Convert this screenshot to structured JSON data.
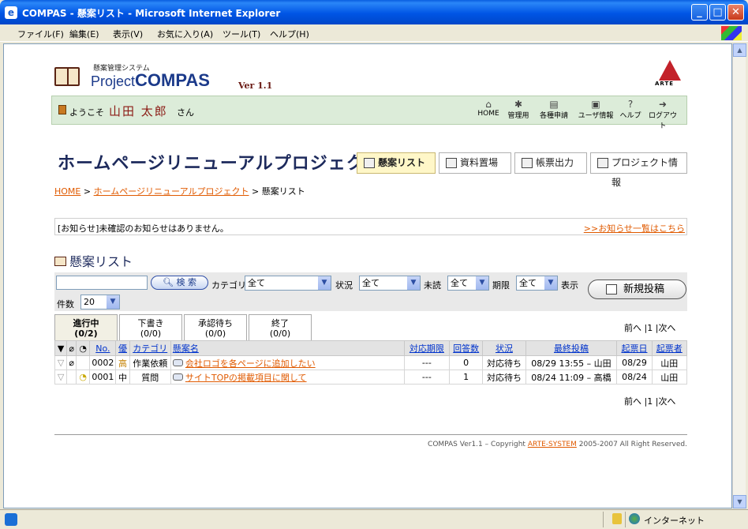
{
  "window": {
    "title": "COMPAS - 懸案リスト - Microsoft Internet Explorer"
  },
  "menu": [
    "ファイル(F)",
    "編集(E)",
    "表示(V)",
    "お気に入り(A)",
    "ツール(T)",
    "ヘルプ(H)"
  ],
  "logo": {
    "subtitle": "懸案管理システム",
    "project": "Project",
    "name": "COMPAS",
    "version": "Ver 1.1",
    "brand": "ARTE"
  },
  "welcome": {
    "prefix": "ようこそ",
    "user": "山田 太郎",
    "suffix": "さん"
  },
  "nav": [
    "HOME",
    "管理用",
    "各種申請",
    "ユーザ情報",
    "ヘルプ",
    "ログアウト"
  ],
  "project_title": "ホームページリニューアルプロジェクト",
  "tabs": [
    "懸案リスト",
    "資料置場",
    "帳票出力",
    "プロジェクト情報"
  ],
  "breadcrumb": {
    "home": "HOME",
    "project": "ホームページリニューアルプロジェクト",
    "current": "懸案リスト",
    "sep": ">"
  },
  "notice": {
    "text": "[お知らせ]未確認のお知らせはありません。",
    "link": ">>お知らせ一覧はこちら"
  },
  "list_title": "懸案リスト",
  "search": {
    "button": "検 索",
    "category_label": "カテゴリ",
    "category_value": "全て",
    "status_label": "状況",
    "status_value": "全て",
    "unread_label": "未読",
    "unread_value": "全て",
    "deadline_label": "期限",
    "deadline_value": "全て",
    "display_label": "表示",
    "count_label": "件数",
    "count_value": "20",
    "new_post": "新規投稿"
  },
  "status_tabs": [
    {
      "label": "進行中",
      "count": "(0/2)"
    },
    {
      "label": "下書き",
      "count": "(0/0)"
    },
    {
      "label": "承認待ち",
      "count": "(0/0)"
    },
    {
      "label": "終了",
      "count": "(0/0)"
    }
  ],
  "pager": {
    "prev": "前へ",
    "sep1": "|",
    "page": "1",
    "sep2": "|",
    "next": "次へ"
  },
  "table": {
    "headers": [
      "No.",
      "優",
      "カテゴリ",
      "懸案名",
      "対応期限",
      "回答数",
      "状況",
      "最終投稿",
      "起票日",
      "起票者"
    ],
    "rows": [
      {
        "no": "0002",
        "pri": "高",
        "cat": "作業依頼",
        "title": "会社ロゴを各ページに追加したい",
        "deadline": "---",
        "answers": "0",
        "status": "対応待ち",
        "last": "08/29 13:55 – 山田",
        "date": "08/29",
        "author": "山田"
      },
      {
        "no": "0001",
        "pri": "中",
        "cat": "質問",
        "title": "サイトTOPの掲載項目に関して",
        "deadline": "---",
        "answers": "1",
        "status": "対応待ち",
        "last": "08/24 11:09 – 高橋",
        "date": "08/24",
        "author": "山田"
      }
    ]
  },
  "footer": {
    "pre": "COMPAS Ver1.1 – Copyright ",
    "link": "ARTE-SYSTEM",
    "post": " 2005-2007 All Right Reserved."
  },
  "status_bar": {
    "zone": "インターネット"
  }
}
